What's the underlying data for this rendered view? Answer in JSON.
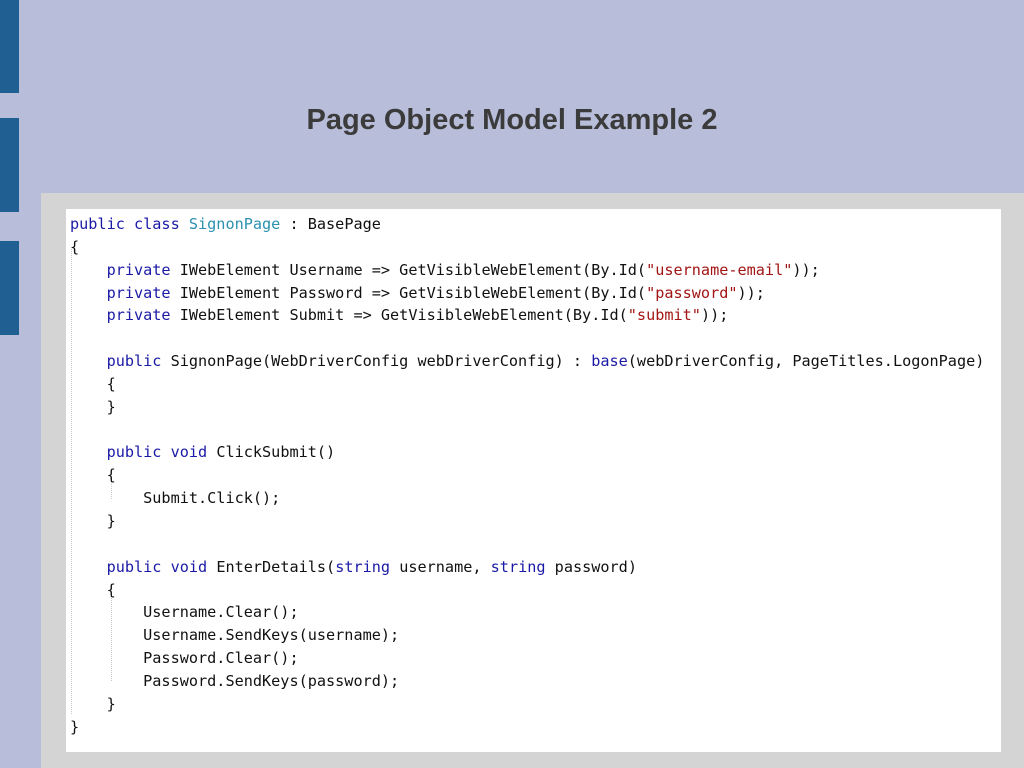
{
  "slide": {
    "title": "Page Object Model Example 2"
  },
  "colors": {
    "background": "#b8bdd9",
    "accent_bar": "#1f5f92",
    "keyword": "#1a1aa6",
    "type_name": "#2b91af",
    "string": "#a31515"
  },
  "code": {
    "language": "csharp",
    "lines": [
      [
        {
          "t": "public class ",
          "k": "kw"
        },
        {
          "t": "SignonPage",
          "k": "ty"
        },
        {
          "t": " : BasePage",
          "k": ""
        }
      ],
      [
        {
          "t": "{",
          "k": ""
        }
      ],
      [
        {
          "t": "    private ",
          "k": "kw"
        },
        {
          "t": "IWebElement Username => GetVisibleWebElement(By.Id(",
          "k": ""
        },
        {
          "t": "\"username-email\"",
          "k": "st"
        },
        {
          "t": "));",
          "k": ""
        }
      ],
      [
        {
          "t": "    private ",
          "k": "kw"
        },
        {
          "t": "IWebElement Password => GetVisibleWebElement(By.Id(",
          "k": ""
        },
        {
          "t": "\"password\"",
          "k": "st"
        },
        {
          "t": "));",
          "k": ""
        }
      ],
      [
        {
          "t": "    private ",
          "k": "kw"
        },
        {
          "t": "IWebElement Submit => GetVisibleWebElement(By.Id(",
          "k": ""
        },
        {
          "t": "\"submit\"",
          "k": "st"
        },
        {
          "t": "));",
          "k": ""
        }
      ],
      [
        {
          "t": "",
          "k": ""
        }
      ],
      [
        {
          "t": "    public ",
          "k": "kw"
        },
        {
          "t": "SignonPage(WebDriverConfig webDriverConfig) : ",
          "k": ""
        },
        {
          "t": "base",
          "k": "kw"
        },
        {
          "t": "(webDriverConfig, PageTitles.LogonPage)",
          "k": ""
        }
      ],
      [
        {
          "t": "    {",
          "k": ""
        }
      ],
      [
        {
          "t": "    }",
          "k": ""
        }
      ],
      [
        {
          "t": "",
          "k": ""
        }
      ],
      [
        {
          "t": "    public void ",
          "k": "kw"
        },
        {
          "t": "ClickSubmit()",
          "k": ""
        }
      ],
      [
        {
          "t": "    {",
          "k": ""
        }
      ],
      [
        {
          "t": "        Submit.Click();",
          "k": ""
        }
      ],
      [
        {
          "t": "    }",
          "k": ""
        }
      ],
      [
        {
          "t": "",
          "k": ""
        }
      ],
      [
        {
          "t": "    public void ",
          "k": "kw"
        },
        {
          "t": "EnterDetails(",
          "k": ""
        },
        {
          "t": "string",
          "k": "kw"
        },
        {
          "t": " username, ",
          "k": ""
        },
        {
          "t": "string",
          "k": "kw"
        },
        {
          "t": " password)",
          "k": ""
        }
      ],
      [
        {
          "t": "    {",
          "k": ""
        }
      ],
      [
        {
          "t": "        Username.Clear();",
          "k": ""
        }
      ],
      [
        {
          "t": "        Username.SendKeys(username);",
          "k": ""
        }
      ],
      [
        {
          "t": "        Password.Clear();",
          "k": ""
        }
      ],
      [
        {
          "t": "        Password.SendKeys(password);",
          "k": ""
        }
      ],
      [
        {
          "t": "    }",
          "k": ""
        }
      ],
      [
        {
          "t": "}",
          "k": ""
        }
      ]
    ]
  }
}
